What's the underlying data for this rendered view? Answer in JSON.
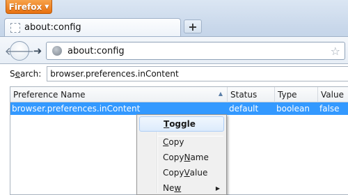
{
  "browser": {
    "menu_button": "Firefox",
    "tab_title": "about:config",
    "new_tab_symbol": "+",
    "url": "about:config"
  },
  "search": {
    "label_pre": "S",
    "label_accel": "e",
    "label_post": "arch:",
    "value": "browser.preferences.inContent"
  },
  "table": {
    "columns": [
      "Preference Name",
      "Status",
      "Type",
      "Value"
    ],
    "sorted_column": "Preference Name",
    "rows": [
      {
        "name": "browser.preferences.inContent",
        "status": "default",
        "type": "boolean",
        "value": "false",
        "selected": true
      }
    ]
  },
  "context_menu": {
    "items": [
      {
        "pre": "",
        "accel": "T",
        "post": "oggle",
        "active": true,
        "bold": true
      },
      {
        "pre": "",
        "accel": "C",
        "post": "opy",
        "active": false,
        "bold": false
      },
      {
        "pre": "Copy ",
        "accel": "N",
        "post": "ame",
        "active": false,
        "bold": false
      },
      {
        "pre": "Copy ",
        "accel": "V",
        "post": "alue",
        "active": false,
        "bold": false
      },
      {
        "pre": "Ne",
        "accel": "w",
        "post": "",
        "active": false,
        "bold": false,
        "has_submenu": true
      }
    ]
  },
  "colors": {
    "selection": "#3399ff",
    "firefox_button": "#e8700f"
  }
}
